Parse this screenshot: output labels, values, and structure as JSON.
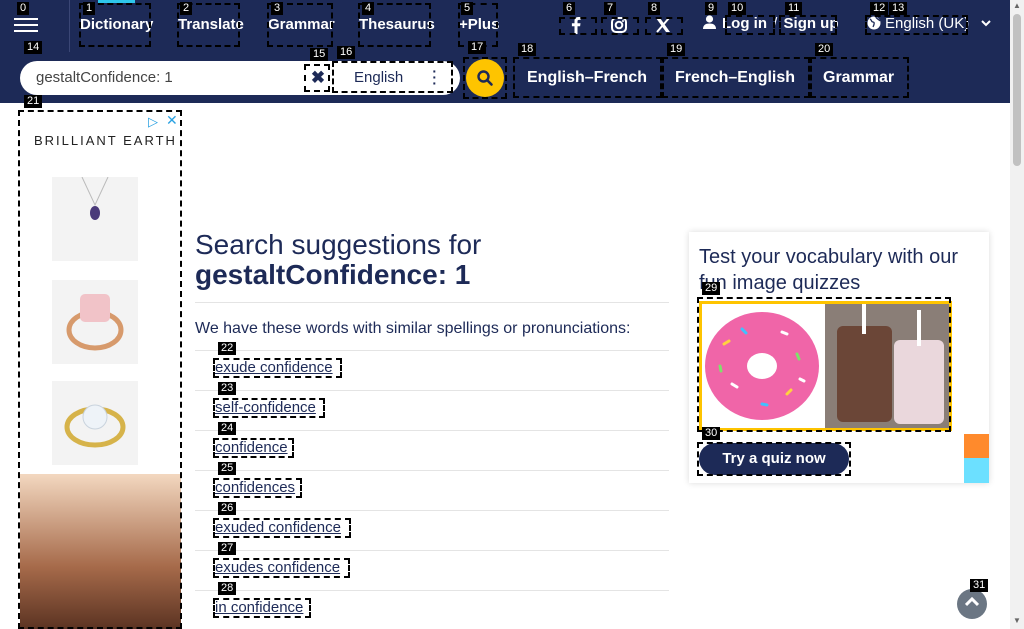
{
  "nav": {
    "dictionary": "Dictionary",
    "translate": "Translate",
    "grammar": "Grammar",
    "thesaurus": "Thesaurus",
    "plus": "+Plus"
  },
  "social": [
    "facebook-icon",
    "instagram-icon",
    "x-icon"
  ],
  "account": {
    "login": "Log in",
    "slash": "/",
    "signup": "Sign up"
  },
  "language": "English (UK)",
  "search": {
    "value": "gestaltConfidence: 1",
    "dictionary": "English"
  },
  "search_tabs": [
    "English–French",
    "French–English",
    "Grammar"
  ],
  "ad": {
    "brand": "BRILLIANT EARTH"
  },
  "results": {
    "heading": "Search suggestions for",
    "term": "gestaltConfidence: 1",
    "intro": "We have these words with similar spellings or pronunciations:",
    "suggestions": [
      "exude confidence",
      "self-confidence",
      "confidence",
      "confidences",
      "exuded confidence",
      "exudes confidence",
      "in confidence"
    ]
  },
  "quiz": {
    "title": "Test your vocabulary with our fun image quizzes",
    "button": "Try a quiz now"
  },
  "markers": [
    "0",
    "1",
    "2",
    "3",
    "4",
    "5",
    "6",
    "7",
    "8",
    "9",
    "10",
    "11",
    "12",
    "13",
    "14",
    "15",
    "16",
    "17",
    "18",
    "19",
    "20",
    "21",
    "22",
    "23",
    "24",
    "25",
    "26",
    "27",
    "28",
    "29",
    "30",
    "31"
  ],
  "colors": {
    "navy": "#1d2a57",
    "accent": "#fec400",
    "cyan": "#2ec7ec"
  }
}
